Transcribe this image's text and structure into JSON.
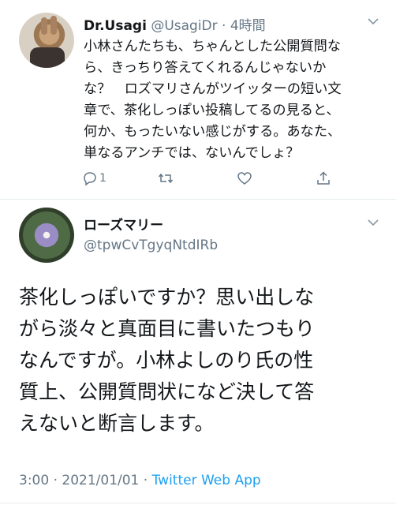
{
  "tweet1": {
    "display_name": "Dr.Usagi",
    "handle_time": "@UsagiDr · 4時間",
    "body_lines": [
      "小林さんたちも、ちゃんとした公開質問な",
      "ら、きっちり答えてくれるんじゃないか",
      "な？　ロズマリさんがツイッターの短い文",
      "章で、茶化しっぽい投稿してるの見ると、",
      "何か、もったいない感じがする。あなた、",
      "単なるアンチでは、ないんでしょ？"
    ],
    "reply_count": "1",
    "icons": {
      "reply": "reply-icon",
      "retweet": "retweet-icon",
      "like": "like-icon",
      "share": "share-icon",
      "menu": "chevron-down-icon"
    }
  },
  "tweet2": {
    "display_name": "ローズマリー",
    "handle": "@tpwCvTgyqNtdIRb",
    "body_lines": [
      "茶化しっぽいですか？思い出しな",
      "がら淡々と真面目に書いたつもり",
      "なんですが。小林よしのり氏の性",
      "質上、公開質問状になど決して答",
      "えないと断言します。"
    ],
    "timestamp": "3:00 · 2021/01/01 · ",
    "source_app": "Twitter Web App"
  },
  "colors": {
    "text": "#14171a",
    "secondary": "#657786",
    "link": "#1da1f2",
    "divider": "#e6ecf0"
  }
}
